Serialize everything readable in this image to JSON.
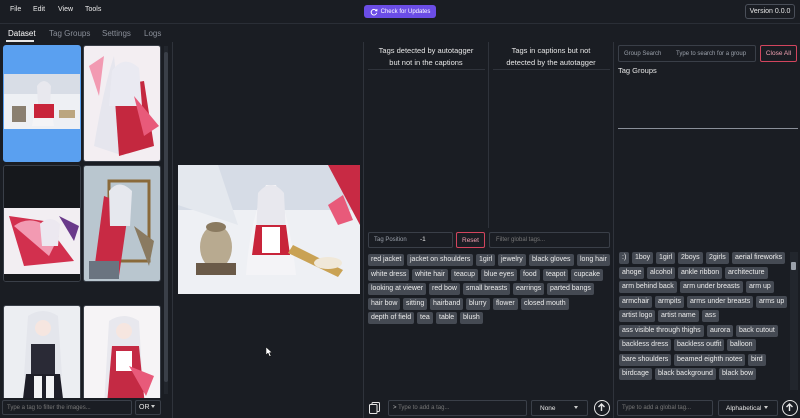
{
  "menu": {
    "file": "File",
    "edit": "Edit",
    "view": "View",
    "tools": "Tools"
  },
  "update_button": "Check for Updates",
  "version": "Version 0.0.0",
  "tabs": [
    "Dataset",
    "Tag Groups",
    "Settings",
    "Logs"
  ],
  "image_filter": {
    "placeholder": "Type a tag to filter the images...",
    "mode": "OR"
  },
  "diff": {
    "left_header_line1": "Tags detected by autotagger",
    "left_header_line2": "but not in the captions",
    "right_header_line1": "Tags in captions but not",
    "right_header_line2": "detected by the autotagger"
  },
  "tag_position": {
    "label": "Tag Position",
    "value": "-1",
    "reset": "Reset",
    "global_filter_placeholder": "Filter global tags..."
  },
  "image_tags": [
    "red jacket",
    "jacket on shoulders",
    "1girl",
    "jewelry",
    "black gloves",
    "long hair",
    "white dress",
    "white hair",
    "teacup",
    "blue eyes",
    "food",
    "teapot",
    "cupcake",
    "looking at viewer",
    "red bow",
    "small breasts",
    "earrings",
    "parted bangs",
    "hair bow",
    "sitting",
    "hairband",
    "blurry",
    "flower",
    "closed mouth",
    "depth of field",
    "tea",
    "table",
    "blush"
  ],
  "add_tag": {
    "placeholder": "Type to add a tag...",
    "position": "None"
  },
  "right_panel": {
    "group_search_label": "Group Search",
    "group_search_placeholder": "Type to search for a group",
    "close_all": "Close All",
    "tag_groups_title": "Tag Groups"
  },
  "global_tags": [
    ":)",
    "1boy",
    "1girl",
    "2boys",
    "2girls",
    "aerial fireworks",
    "ahoge",
    "alcohol",
    "ankle ribbon",
    "architecture",
    "arm behind back",
    "arm under breasts",
    "arm up",
    "armchair",
    "armpits",
    "arms under breasts",
    "arms up",
    "artist logo",
    "artist name",
    "ass",
    "ass visible through thighs",
    "aurora",
    "back cutout",
    "backless dress",
    "backless outfit",
    "balloon",
    "bare shoulders",
    "beamed eighth notes",
    "bird",
    "birdcage",
    "black background",
    "black bow"
  ],
  "global_add": {
    "placeholder": "Type to add a global tag...",
    "sort": "Alphabetical"
  },
  "colors": {
    "accent": "#6b4de6",
    "selected": "#5aa0f0",
    "danger": "#d2455e",
    "tag_bg": "#454a53",
    "background": "#1a1d23"
  }
}
